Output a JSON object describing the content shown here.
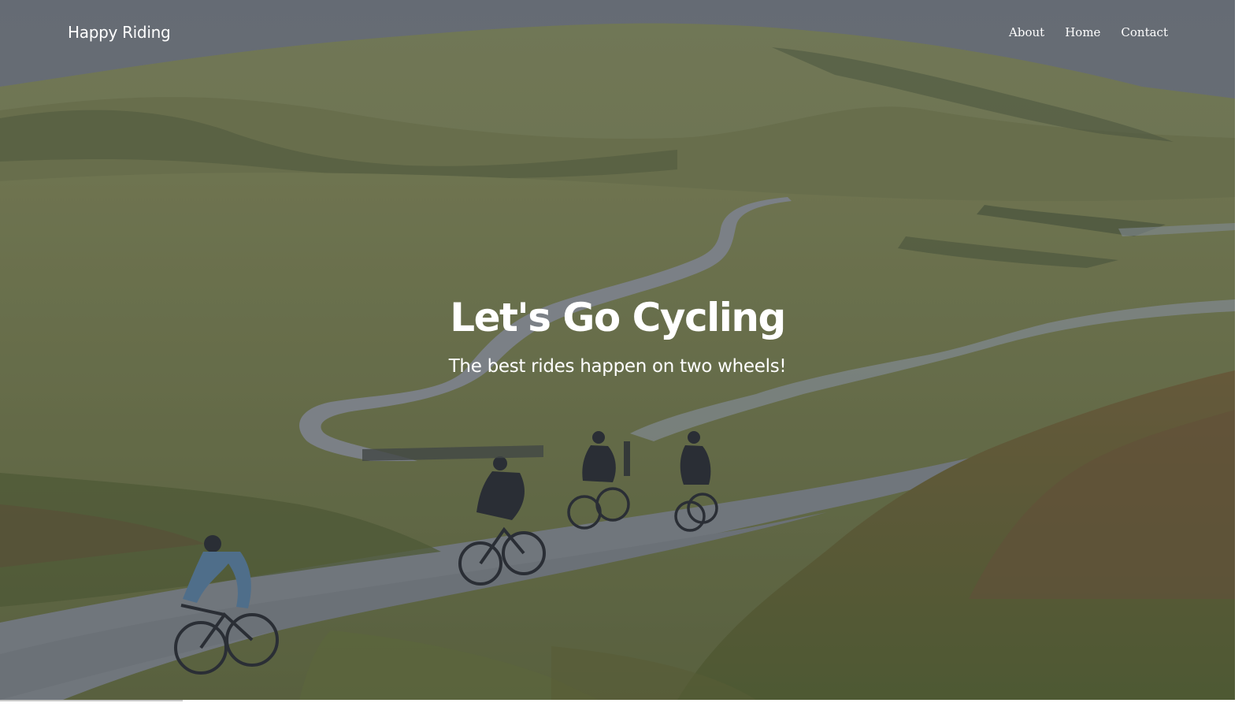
{
  "navbar": {
    "brand": "Happy Riding",
    "links": [
      {
        "label": "About"
      },
      {
        "label": "Home"
      },
      {
        "label": "Contact"
      }
    ]
  },
  "hero": {
    "title": "Let's Go Cycling",
    "subtitle": "The best rides happen on two wheels!"
  },
  "colors": {
    "text": "#ffffff",
    "overlay": "#28303e"
  }
}
